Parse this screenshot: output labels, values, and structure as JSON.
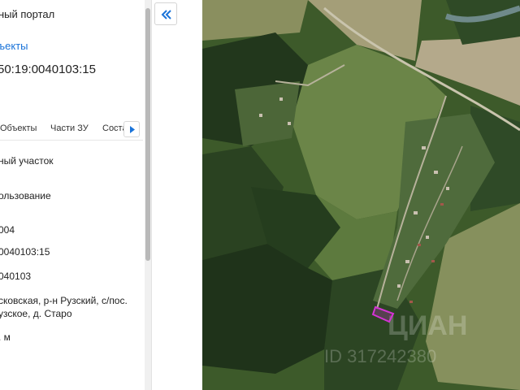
{
  "panel": {
    "portal_title": "ный портал",
    "objects_link": "ъекты",
    "cadastral_number": "50:19:0040103:15",
    "tabs": [
      "Объекты",
      "Части ЗУ",
      "Соста"
    ],
    "fields": [
      "ный участок",
      "ользование",
      "004",
      "0040103:15",
      "040103",
      "сковская, р-н Рузский, с/пос.",
      "узское, д. Старо",
      ". м"
    ]
  },
  "map": {
    "watermark": "ЦИАН",
    "watermark_id": "ID 317242380",
    "parcel_color": "#d633d6"
  }
}
